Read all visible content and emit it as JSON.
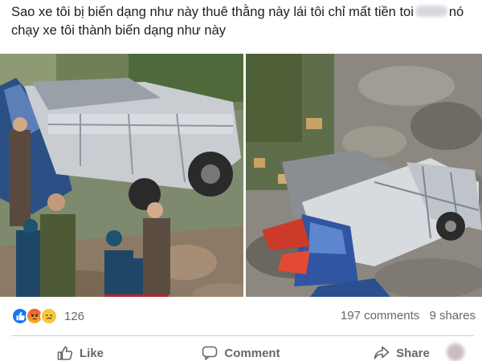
{
  "post": {
    "text_part1": "Sao xe tôi bị biến dạng như này thuê thằng này lái tôi chỉ mất tiền toi",
    "text_part2": "nó chạy xe tôi thành biến dạng như này"
  },
  "reactions": {
    "types": [
      "like",
      "angry",
      "sad"
    ],
    "count": "126"
  },
  "stats": {
    "comments": "197 comments",
    "shares": "9 shares"
  },
  "actions": {
    "like_label": "Like",
    "comment_label": "Comment",
    "share_label": "Share"
  },
  "colors": {
    "like_blue": "#1877f2",
    "text_secondary": "#65676b"
  }
}
